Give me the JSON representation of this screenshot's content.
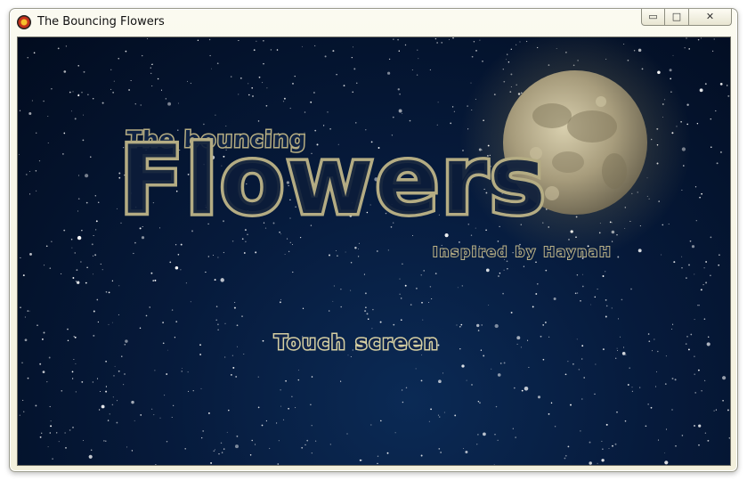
{
  "window": {
    "title": "The Bouncing Flowers",
    "controls": {
      "minimize": "▭",
      "maximize": "□",
      "close": "✕"
    }
  },
  "game": {
    "subtitle": "The bouncing",
    "title": "Flowers",
    "credit": "Inspired by HaynaH",
    "prompt": "Touch screen"
  },
  "colors": {
    "sky": "#061a3b",
    "outline": "#b4ac83",
    "text_fill": "#0c1c3a"
  }
}
